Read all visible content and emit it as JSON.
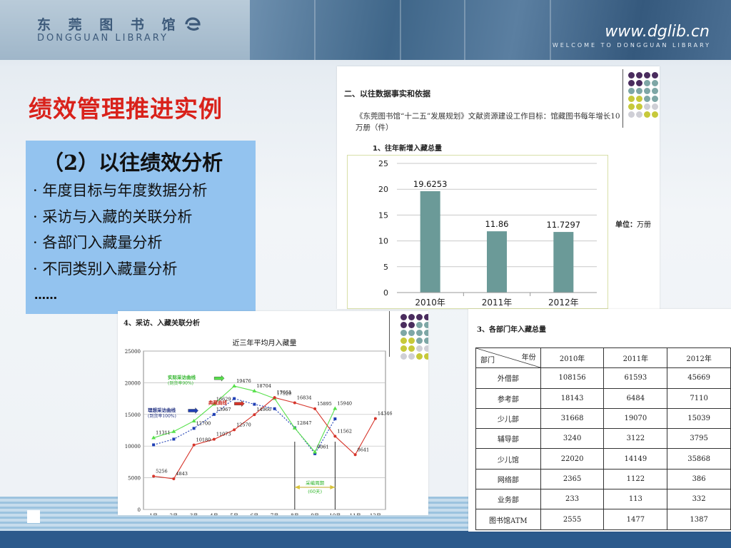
{
  "header": {
    "logo_cn": "东 莞 图 书 馆",
    "logo_en": "DONGGUAN LIBRARY",
    "logo_icon": "library-e-logo-icon",
    "site_url": "www.dglib.cn",
    "welcome": "WELCOME TO DONGGUAN LIBRARY"
  },
  "slide": {
    "title": "绩效管理推进实例",
    "panel_heading": "（2）以往绩效分析",
    "bullets": [
      "· 年度目标与年度数据分析",
      "· 采访与入藏的关联分析",
      "· 各部门入藏量分析",
      "· 不同类别入藏量分析"
    ],
    "ellipsis": "……"
  },
  "colors": {
    "title_red": "#d9221b",
    "panel_blue": "#93c3ef",
    "bar_teal": "#6b9a98",
    "dot_purple": "#4a2c5e",
    "dot_teal": "#7ea7a6",
    "dot_yellow": "#c7c93a",
    "dot_grey": "#cfcfd6",
    "line_blue": "#1f3fb5",
    "line_green": "#56e04a",
    "line_red": "#d6342a"
  },
  "card1": {
    "heading": "二、以往数据事实和依据",
    "paragraph": "《东莞图书馆“十二五”发展规划》文献资源建设工作目标：馆藏图书每年增长10万册（件）",
    "subheading": "1、往年新增入藏总量",
    "unit_label": "单位：",
    "unit_value": "万册"
  },
  "card2": {
    "heading": "4、采访、入藏关联分析"
  },
  "card3": {
    "heading": "3、各部门年入藏总量",
    "corner_row": "部门",
    "corner_col": "年份",
    "years": [
      "2010年",
      "2011年",
      "2012年"
    ],
    "rows": [
      {
        "dept": "外借部",
        "values": [
          "108156",
          "61593",
          "45669"
        ]
      },
      {
        "dept": "参考部",
        "values": [
          "18143",
          "6484",
          "7110"
        ]
      },
      {
        "dept": "少儿部",
        "values": [
          "31668",
          "19070",
          "15039"
        ]
      },
      {
        "dept": "辅导部",
        "values": [
          "3240",
          "3122",
          "3795"
        ]
      },
      {
        "dept": "少儿馆",
        "values": [
          "22020",
          "14149",
          "35868"
        ]
      },
      {
        "dept": "网络部",
        "values": [
          "2365",
          "1122",
          "386"
        ]
      },
      {
        "dept": "业务部",
        "values": [
          "233",
          "113",
          "332"
        ]
      },
      {
        "dept": "图书馆ATM",
        "values": [
          "2555",
          "1477",
          "1387"
        ]
      }
    ]
  },
  "chart_data": [
    {
      "type": "bar",
      "title": "",
      "categories": [
        "2010年",
        "2011年",
        "2012年"
      ],
      "values": [
        19.6253,
        11.86,
        11.7297
      ],
      "value_labels": [
        "19.6253",
        "11.86",
        "11.7297"
      ],
      "yticks": [
        "0",
        "5",
        "10",
        "15",
        "20",
        "25"
      ],
      "ylim": [
        0,
        25
      ],
      "grid": true,
      "legend": "none"
    },
    {
      "type": "line",
      "title": "近三年平均月入藏量",
      "categories": [
        "1月",
        "2月",
        "3月",
        "4月",
        "5月",
        "6月",
        "7月",
        "8月",
        "9月",
        "10月",
        "11月",
        "12月"
      ],
      "yticks": [
        "0",
        "5000",
        "10000",
        "15000",
        "20000",
        "25000"
      ],
      "ylim": [
        0,
        25000
      ],
      "grid": true,
      "series": [
        {
          "name": "理想采访曲线",
          "sub": "(到货率100%)",
          "color": "#1f3fb5",
          "values": [
            10200,
            11100,
            12800,
            15000,
            17500,
            16600,
            15900,
            12900,
            8800,
            14300,
            null,
            null
          ],
          "labels": [
            null,
            null,
            "12700",
            "13967",
            null,
            null,
            null,
            null,
            null,
            null,
            null,
            null
          ]
        },
        {
          "name": "实际采访曲线",
          "sub": "(到货率90%)",
          "color": "#56e04a",
          "values": [
            11311,
            12300,
            13967,
            16629,
            19476,
            18704,
            17520,
            12847,
            9061,
            15940,
            null,
            null
          ],
          "labels": [
            "11311",
            null,
            null,
            "16629",
            "19476",
            "18704",
            "17520",
            "12847",
            "9061",
            "15940",
            null,
            null
          ]
        },
        {
          "name": "典藏曲线",
          "sub": "",
          "color": "#d6342a",
          "values": [
            5256,
            4843,
            10180,
            11073,
            12570,
            14966,
            17661,
            16834,
            15895,
            11562,
            8641,
            14346
          ],
          "labels": [
            "5256",
            "4843",
            "10180",
            "11073",
            "12570",
            "14966",
            "17661",
            "16834",
            "15895",
            "11562",
            "8641",
            "14346"
          ]
        }
      ],
      "annotations": [
        "采编周期",
        "(60天)"
      ]
    }
  ]
}
